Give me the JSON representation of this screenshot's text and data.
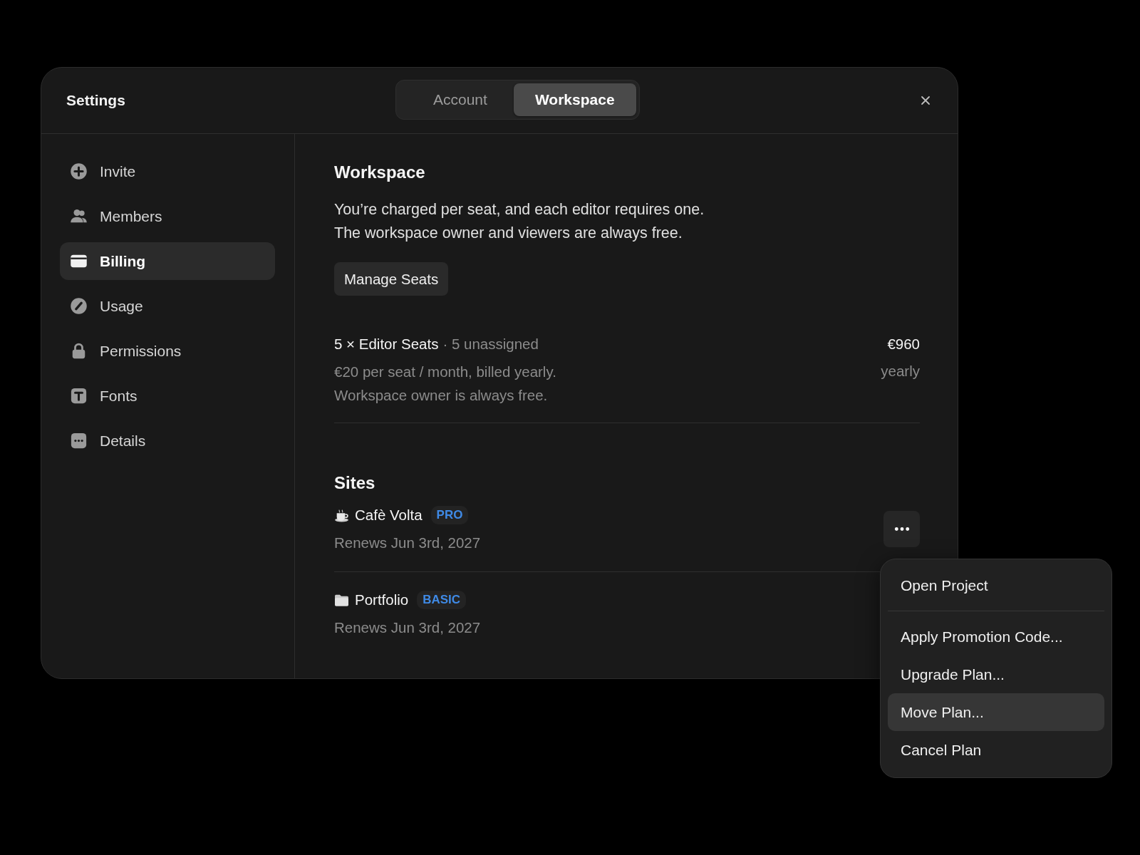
{
  "window": {
    "title": "Settings"
  },
  "tabs": [
    {
      "label": "Account",
      "selected": false
    },
    {
      "label": "Workspace",
      "selected": true
    }
  ],
  "sidebar": {
    "items": [
      {
        "kind": "plus",
        "label": "Invite",
        "selected": false
      },
      {
        "kind": "people",
        "label": "Members",
        "selected": false
      },
      {
        "kind": "card",
        "label": "Billing",
        "selected": true
      },
      {
        "kind": "gauge",
        "label": "Usage",
        "selected": false
      },
      {
        "kind": "lock",
        "label": "Permissions",
        "selected": false
      },
      {
        "kind": "type",
        "label": "Fonts",
        "selected": false
      },
      {
        "kind": "dots",
        "label": "Details",
        "selected": false
      }
    ]
  },
  "workspace": {
    "heading": "Workspace",
    "description": [
      "You’re charged per seat, and each editor requires one.",
      "The workspace owner and viewers are always free."
    ],
    "button": "Manage Seats",
    "seats": {
      "title": "5 × Editor Seats",
      "note": "· 5 unassigned",
      "details": [
        "€20 per seat / month, billed yearly.",
        "Workspace owner is always free."
      ],
      "price": "€960",
      "period": "yearly"
    }
  },
  "sites": {
    "heading": "Sites",
    "items": [
      {
        "kind": "cup",
        "name": "Cafè Volta",
        "plan": "PRO",
        "renews": "Renews Jun 3rd, 2027",
        "more_button": true
      },
      {
        "kind": "folder",
        "name": "Portfolio",
        "plan": "BASIC",
        "renews": "Renews Jun 3rd, 2027",
        "more_button": false
      }
    ]
  },
  "menu": {
    "items": [
      {
        "label": "Open Project",
        "selected": false,
        "divider_after": true
      },
      {
        "label": "Apply Promotion Code...",
        "selected": false,
        "divider_after": false
      },
      {
        "label": "Upgrade Plan...",
        "selected": false,
        "divider_after": false
      },
      {
        "label": "Move Plan...",
        "selected": true,
        "divider_after": false
      },
      {
        "label": "Cancel Plan",
        "selected": false,
        "divider_after": false
      }
    ]
  }
}
